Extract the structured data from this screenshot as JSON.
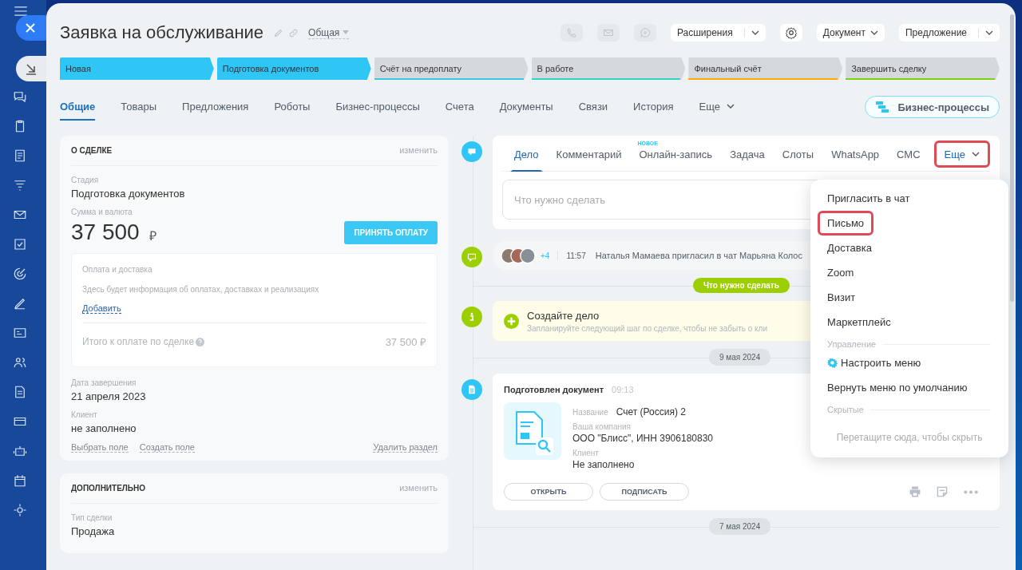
{
  "header": {
    "title": "Заявка на обслуживание",
    "category": "Общая"
  },
  "toolbar": [
    {
      "kind": "call"
    },
    {
      "kind": "mail"
    },
    {
      "kind": "chat"
    },
    {
      "kind": "split",
      "label": "Расширения"
    },
    {
      "kind": "settings"
    },
    {
      "kind": "dropdown",
      "label": "Документ"
    },
    {
      "kind": "split",
      "label": "Предложение"
    }
  ],
  "stages": [
    {
      "label": "Новая",
      "passed": true,
      "color": "#2fc6f6"
    },
    {
      "label": "Подготовка документов",
      "passed": true,
      "color": "#2fc6f6"
    },
    {
      "label": "Счёт на предоплату",
      "passed": false,
      "color": "#39c7e8"
    },
    {
      "label": "В работе",
      "passed": false,
      "color": "#2fd6c6"
    },
    {
      "label": "Финальный счёт",
      "passed": false,
      "color": "#ffa900"
    },
    {
      "label": "Завершить сделку",
      "passed": false,
      "color": "#7bd500"
    }
  ],
  "tabs": [
    {
      "label": "Общие",
      "selected": true,
      "kind": "link"
    },
    {
      "label": "Товары",
      "selected": false,
      "kind": "link"
    },
    {
      "label": "Предложения",
      "selected": false,
      "kind": "link"
    },
    {
      "label": "Роботы",
      "selected": false,
      "kind": "link"
    },
    {
      "label": "Бизнес-процессы",
      "selected": false,
      "kind": "link"
    },
    {
      "label": "Счета",
      "selected": false,
      "kind": "link"
    },
    {
      "label": "Документы",
      "selected": false,
      "kind": "link"
    },
    {
      "label": "Связи",
      "selected": false,
      "kind": "link"
    },
    {
      "label": "История",
      "selected": false,
      "kind": "link"
    },
    {
      "label": "Еще",
      "selected": false,
      "kind": "dropdown"
    }
  ],
  "bp_button": "Бизнес-процессы",
  "deal_card": {
    "title": "О СДЕЛКЕ",
    "edit": "изменить",
    "fields_top": [
      {
        "label": "Стадия",
        "value": "Подготовка документов"
      }
    ],
    "sum_label": "Сумма и валюта",
    "amount": "37 500",
    "currency": "₽",
    "pay_button": "ПРИНЯТЬ ОПЛАТУ",
    "payment": {
      "title": "Оплата и доставка",
      "text": "Здесь будет информация об оплатах, доставках и реализациях",
      "add": "Добавить",
      "total_label": "Итого к оплате по сделке",
      "total": "37 500 ₽"
    },
    "fields_bottom": [
      {
        "label": "Дата завершения",
        "value": "21 апреля 2023"
      },
      {
        "label": "Клиент",
        "value": "не заполнено"
      }
    ],
    "links": [
      "Выбрать поле",
      "Создать поле"
    ],
    "delete": "Удалить раздел"
  },
  "extra_card": {
    "title": "ДОПОЛНИТЕЛЬНО",
    "edit": "изменить",
    "fields": [
      {
        "label": "Тип сделки",
        "value": "Продажа"
      }
    ]
  },
  "composer": {
    "tabs": [
      {
        "label": "Дело",
        "selected": true,
        "highlighted": false,
        "kind": "link"
      },
      {
        "label": "Комментарий",
        "selected": false,
        "highlighted": false,
        "kind": "link"
      },
      {
        "label": "Онлайн-запись",
        "selected": false,
        "highlighted": false,
        "kind": "link",
        "badge": "НОВОЕ"
      },
      {
        "label": "Задача",
        "selected": false,
        "highlighted": false,
        "kind": "link"
      },
      {
        "label": "Слоты",
        "selected": false,
        "highlighted": false,
        "kind": "link"
      },
      {
        "label": "WhatsApp",
        "selected": false,
        "highlighted": false,
        "kind": "link"
      },
      {
        "label": "СМС",
        "selected": false,
        "highlighted": false,
        "kind": "link"
      },
      {
        "label": "Еще",
        "selected": true,
        "highlighted": true,
        "kind": "dropdown"
      }
    ],
    "placeholder": "Что нужно сделать"
  },
  "chat_event": {
    "more": "+4",
    "time": "11:57",
    "text": "Наталья Мамаева пригласил в чат Марьяна Колос"
  },
  "section_pill": "Что нужно сделать",
  "todo": {
    "title": "Создайте дело",
    "text": "Запланируйте следующий шаг по сделке, чтобы не забыть о кли"
  },
  "date_1": "9 мая 2024",
  "document": {
    "title": "Подготовлен документ",
    "time": "09:13",
    "fields": [
      {
        "kind": "inline",
        "label": "Название",
        "value": "Счет (Россия) 2"
      },
      {
        "kind": "stacked",
        "label": "Ваша компания",
        "value": "ООО \"Блисс\", ИНН 3906180830"
      },
      {
        "kind": "stacked",
        "label": "Клиент",
        "value": "Не заполнено"
      }
    ],
    "buttons": [
      "ОТКРЫТЬ",
      "ПОДПИСАТЬ"
    ]
  },
  "date_2": "7 мая 2024",
  "menu": [
    {
      "kind": "item",
      "label": "Пригласить в чат",
      "highlighted": false
    },
    {
      "kind": "item",
      "label": "Письмо",
      "highlighted": true
    },
    {
      "kind": "item",
      "label": "Доставка",
      "highlighted": false
    },
    {
      "kind": "item",
      "label": "Zoom",
      "highlighted": false
    },
    {
      "kind": "item",
      "label": "Визит",
      "highlighted": false
    },
    {
      "kind": "item",
      "label": "Маркетплейс",
      "highlighted": false
    },
    {
      "kind": "section",
      "label": "Управление"
    },
    {
      "kind": "settings",
      "label": "Настроить меню",
      "highlighted": false
    },
    {
      "kind": "item",
      "label": "Вернуть меню по умолчанию",
      "highlighted": false
    },
    {
      "kind": "section",
      "label": "Скрытые"
    },
    {
      "kind": "hint",
      "label": "Перетащите сюда, чтобы скрыть"
    }
  ]
}
